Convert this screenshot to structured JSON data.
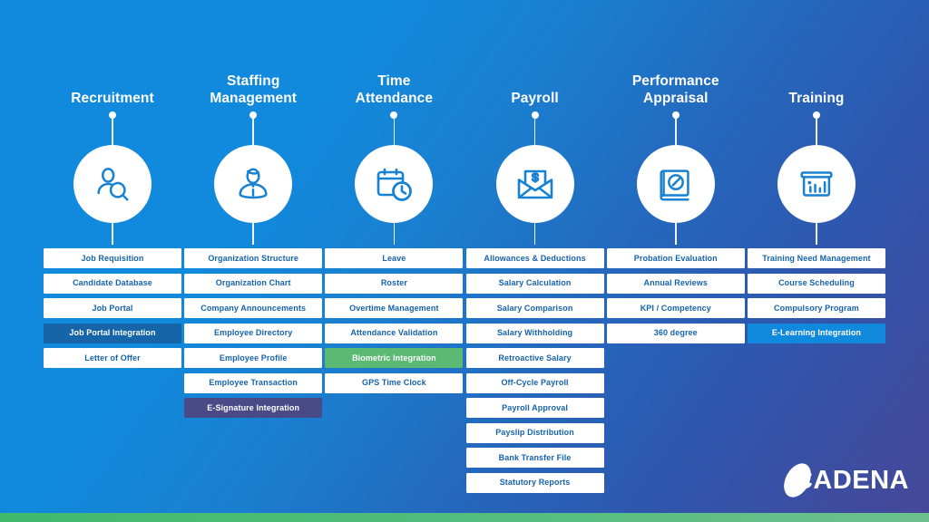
{
  "brand": {
    "logo_text": "ADENA",
    "logo_full": "CADENA",
    "logo_mark_icon": "ellipse-swoosh-icon"
  },
  "theme": {
    "bg_start": "#1189dc",
    "bg_end": "#46489a",
    "item_bg": "#ffffff",
    "item_text": "#1663ad",
    "accent_blue": "#1189dc",
    "accent_dark_blue": "#1565a8",
    "accent_green": "#5cb974",
    "accent_purple": "#4a4a86",
    "bottom_strip": "#4fbb79"
  },
  "columns": [
    {
      "title": "Recruitment",
      "icon": "person-search-icon",
      "items": [
        {
          "label": "Job Requisition",
          "style": "plain"
        },
        {
          "label": "Candidate Database",
          "style": "plain"
        },
        {
          "label": "Job Portal",
          "style": "plain"
        },
        {
          "label": "Job Portal Integration",
          "style": "hl-dblue"
        },
        {
          "label": "Letter of Offer",
          "style": "plain"
        }
      ]
    },
    {
      "title": "Staffing\nManagement",
      "icon": "person-info-icon",
      "items": [
        {
          "label": "Organization Structure",
          "style": "plain"
        },
        {
          "label": "Organization Chart",
          "style": "plain"
        },
        {
          "label": "Company Announcements",
          "style": "plain"
        },
        {
          "label": "Employee Directory",
          "style": "plain"
        },
        {
          "label": "Employee Profile",
          "style": "plain"
        },
        {
          "label": "Employee Transaction",
          "style": "plain"
        },
        {
          "label": "E-Signature Integration",
          "style": "hl-purple"
        }
      ]
    },
    {
      "title": "Time\nAttendance",
      "icon": "calendar-clock-icon",
      "items": [
        {
          "label": "Leave",
          "style": "plain"
        },
        {
          "label": "Roster",
          "style": "plain"
        },
        {
          "label": "Overtime Management",
          "style": "plain"
        },
        {
          "label": "Attendance Validation",
          "style": "plain"
        },
        {
          "label": "Biometric Integration",
          "style": "hl-green"
        },
        {
          "label": "GPS Time Clock",
          "style": "plain"
        }
      ]
    },
    {
      "title": "Payroll",
      "icon": "envelope-dollar-icon",
      "items": [
        {
          "label": "Allowances & Deductions",
          "style": "plain"
        },
        {
          "label": "Salary Calculation",
          "style": "plain"
        },
        {
          "label": "Salary Comparison",
          "style": "plain"
        },
        {
          "label": "Salary Withholding",
          "style": "plain"
        },
        {
          "label": "Retroactive Salary",
          "style": "plain"
        },
        {
          "label": "Off-Cycle Payroll",
          "style": "plain"
        },
        {
          "label": "Payroll Approval",
          "style": "plain"
        },
        {
          "label": "Payslip Distribution",
          "style": "plain"
        },
        {
          "label": "Bank Transfer File",
          "style": "plain"
        },
        {
          "label": "Statutory Reports",
          "style": "plain"
        }
      ]
    },
    {
      "title": "Performance\nAppraisal",
      "icon": "book-gauge-icon",
      "items": [
        {
          "label": "Probation Evaluation",
          "style": "plain"
        },
        {
          "label": "Annual Reviews",
          "style": "plain"
        },
        {
          "label": "KPI / Competency",
          "style": "plain"
        },
        {
          "label": "360 degree",
          "style": "plain"
        }
      ]
    },
    {
      "title": "Training",
      "icon": "presentation-chart-icon",
      "items": [
        {
          "label": "Training Need Management",
          "style": "plain"
        },
        {
          "label": "Course Scheduling",
          "style": "plain"
        },
        {
          "label": "Compulsory Program",
          "style": "plain"
        },
        {
          "label": "E-Learning Integration",
          "style": "hl-blue"
        }
      ]
    }
  ]
}
